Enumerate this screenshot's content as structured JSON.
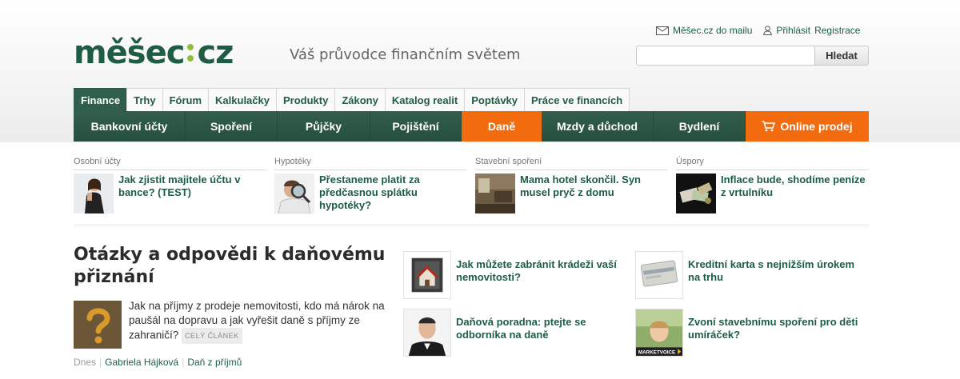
{
  "logo": {
    "left": "měšec",
    "right": "cz"
  },
  "tagline": "Váš průvodce finančním světem",
  "toplinks": {
    "mail": "Měšec.cz do mailu",
    "login": "Přihlásit",
    "register": "Registrace"
  },
  "search": {
    "placeholder": "",
    "button": "Hledat"
  },
  "tabs": [
    "Finance",
    "Trhy",
    "Fórum",
    "Kalkulačky",
    "Produkty",
    "Zákony",
    "Katalog realit",
    "Poptávky",
    "Práce ve financích"
  ],
  "mainnav": [
    "Bankovní účty",
    "Spoření",
    "Půjčky",
    "Pojištění",
    "Daně",
    "Mzdy a důchod",
    "Bydlení",
    "Online prodej"
  ],
  "featured": [
    {
      "category": "Osobní účty",
      "title": "Jak zjistit majitele účtu v bance? (TEST)"
    },
    {
      "category": "Hypotéky",
      "title": "Přestaneme platit za předčasnou splátku hypotéky?"
    },
    {
      "category": "Stavební spoření",
      "title": "Mama hotel skončil. Syn musel pryč z domu"
    },
    {
      "category": "Úspory",
      "title": "Inflace bude, shodíme peníze z vrtulníku"
    }
  ],
  "main_article": {
    "title": "Otázky a odpovědi k daňovému přiznání",
    "perex": "Jak na příjmy z prodeje nemovitosti, kdo má nárok na paušál na dopravu a jak vyřešit daně s příjmy ze zahraničí?",
    "badge": "CELÝ ČLÁNEK",
    "date": "Dnes",
    "author": "Gabriela Hájková",
    "tag": "Daň z příjmů"
  },
  "side_articles": [
    {
      "title": "Jak můžete zabránit krádeži vaší nemovitosti?"
    },
    {
      "title": "Kreditní karta s nejnižším úrokem na trhu"
    },
    {
      "title": "Daňová poradna: ptejte se odborníka na daně"
    },
    {
      "title": "Zvoní stavebnímu spoření pro děti umíráček?",
      "thumb_label": "MARKETVOICE"
    }
  ],
  "colors": {
    "brand_green": "#1e5c44",
    "accent_green": "#8fbf3a",
    "nav_bg": "#2b5645",
    "orange": "#f26b0f"
  }
}
